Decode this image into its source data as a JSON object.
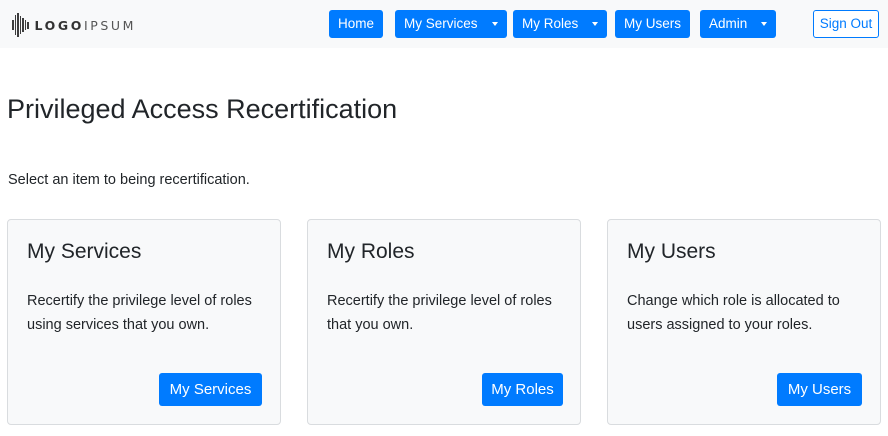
{
  "brand": {
    "logo_bold": "LOGO",
    "logo_light": "IPSUM"
  },
  "nav": {
    "home": "Home",
    "services": "My Services",
    "roles": "My Roles",
    "users": "My Users",
    "admin": "Admin",
    "sign_out": "Sign Out"
  },
  "colors": {
    "primary": "#007bff",
    "navbar_bg": "#f8f9fa",
    "card_bg": "#f8f9fa"
  },
  "page": {
    "title": "Privileged Access Recertification",
    "intro": "Select an item to being recertification."
  },
  "cards": [
    {
      "title": "My Services",
      "text": "Recertify the privilege level of roles using services that you own.",
      "button": "My Services"
    },
    {
      "title": "My Roles",
      "text": "Recertify the privilege level of roles that you own.",
      "button": "My Roles"
    },
    {
      "title": "My Users",
      "text": "Change which role is allocated to users assigned to your roles.",
      "button": "My Users"
    }
  ]
}
